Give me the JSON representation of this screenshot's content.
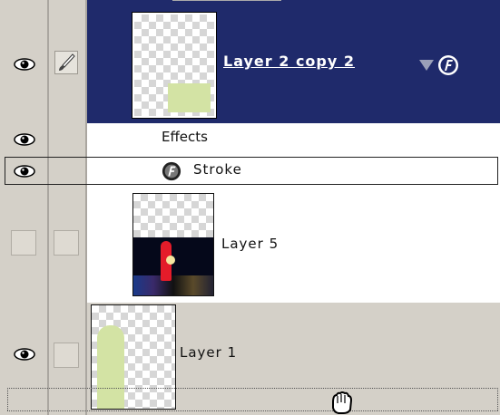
{
  "layers": {
    "layer_2_copy_2": {
      "name": "Layer 2 copy 2",
      "selected": true
    },
    "effects": {
      "label": "Effects"
    },
    "stroke": {
      "label": "Stroke"
    },
    "layer_5": {
      "name": "Layer 5"
    },
    "layer_1": {
      "name": "Layer 1"
    }
  },
  "colors": {
    "selected_bg": "#1f2a6b",
    "panel_bg": "#d4d0c8",
    "thumb_green": "#d3e3a4"
  }
}
